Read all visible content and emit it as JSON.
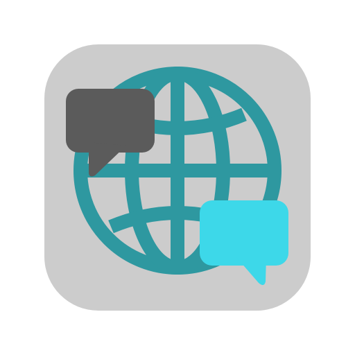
{
  "icon": {
    "semantic": "globe-chat-app-icon",
    "parts": [
      "app-tile",
      "globe-icon",
      "chat-bubble-icon",
      "chat-bubble-icon"
    ]
  },
  "colors": {
    "tile": "#cccccc",
    "globe": "#2e98a0",
    "bubble_dark": "#5b5b5b",
    "bubble_light": "#3dd8e9"
  }
}
